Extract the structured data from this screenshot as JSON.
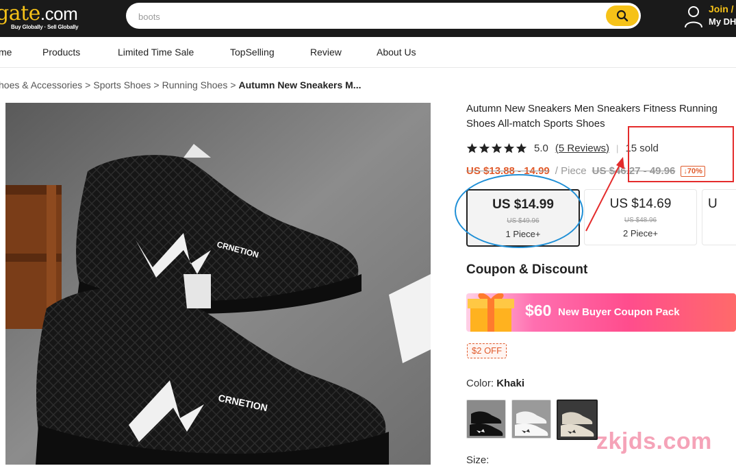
{
  "header": {
    "logo_main": "gate",
    "logo_dot": ".com",
    "logo_tagline": "Buy Globally · Sell Globally",
    "search_placeholder": "boots",
    "search_icon": "search-icon",
    "account_icon": "user-icon",
    "join_label": "Join /",
    "mydh_label": "My DH",
    "brand_color": "#f6c218"
  },
  "nav": {
    "items": [
      "me",
      "Products",
      "Limited Time Sale",
      "TopSelling",
      "Review",
      "About Us"
    ]
  },
  "breadcrumb": {
    "items": [
      "hoes & Accessories",
      "Sports Shoes",
      "Running Shoes"
    ],
    "current": "Autumn New Sneakers M..."
  },
  "product": {
    "image_alt_icon": "sneakers-product-image",
    "brand_print": "CRNETION",
    "title": "Autumn New Sneakers Men Sneakers Fitness Running Shoes All-match Sports Shoes",
    "rating": "5.0",
    "stars": 5,
    "reviews_label": "(5 Reviews)",
    "divider": "|",
    "sold_label": "15 sold",
    "price_range": "US $13.88 - 14.99",
    "per_unit": "/ Piece",
    "old_range": "US $46.27 - 49.96",
    "off_badge": "↓70%",
    "tiers": [
      {
        "price": "US $14.99",
        "old": "US $49.96",
        "qty": "1 Piece+",
        "selected": true
      },
      {
        "price": "US $14.69",
        "old": "US $48.96",
        "qty": "2 Piece+",
        "selected": false
      },
      {
        "price": "U",
        "old": "",
        "qty": "",
        "selected": false
      }
    ],
    "coupon_section_title": "Coupon & Discount",
    "coupon_amount": "$60",
    "coupon_text": "New Buyer Coupon Pack",
    "off_tag": "$2 OFF",
    "color_label": "Color:",
    "color_value": "Khaki",
    "swatches": [
      "black-sneaker-swatch",
      "white-sneaker-swatch",
      "khaki-sneaker-swatch"
    ],
    "size_label": "Size:",
    "accent_color": "#e05a2a"
  },
  "watermark": "zkjds.com"
}
